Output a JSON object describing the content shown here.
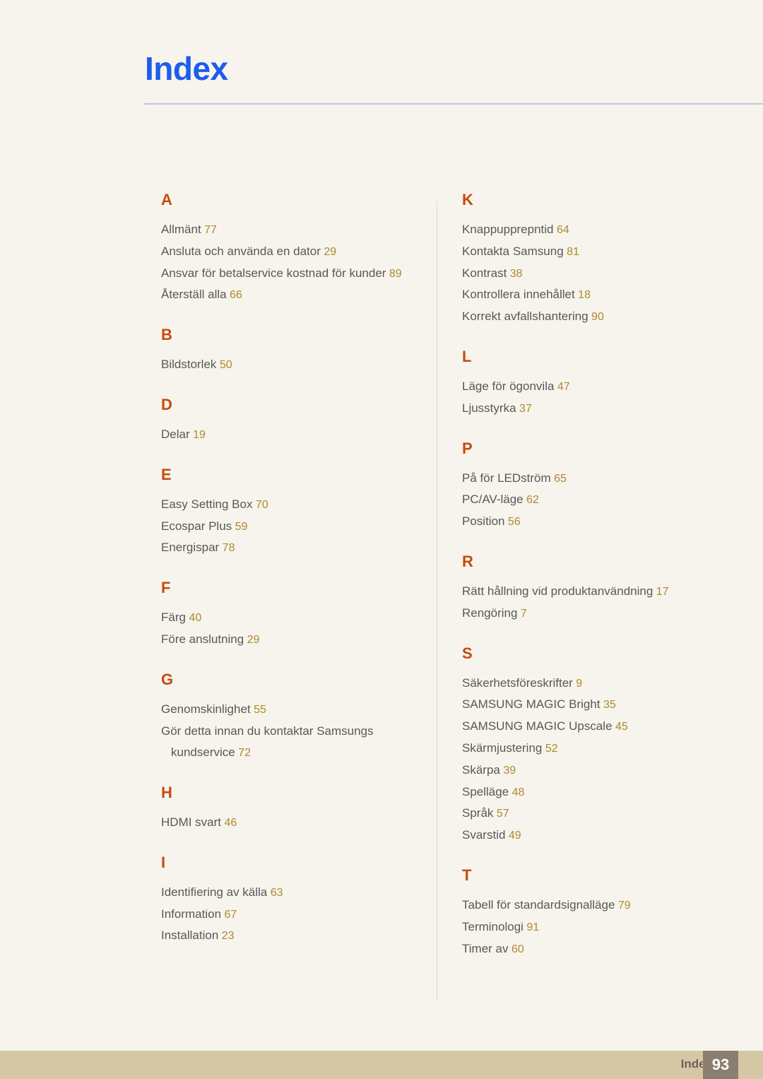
{
  "header": {
    "title": "Index"
  },
  "footer": {
    "label": "Index",
    "page_number": "93"
  },
  "colors": {
    "background": "#f6f4ec",
    "title_blue": "#1d5ced",
    "letter_orange": "#c84a10",
    "entry_gray": "#585858",
    "page_number_gold": "#ae8a2e",
    "rule_lavender": "#c9c2de",
    "divider": "#ded6c4",
    "footer_bar": "#d6c7a4",
    "footer_box": "#8a7f70"
  },
  "columns": {
    "left": [
      {
        "letter": "A",
        "entries": [
          {
            "text": "Allmänt",
            "page": "77"
          },
          {
            "text": "Ansluta och använda en dator",
            "page": "29"
          },
          {
            "text": "Ansvar för betalservice kostnad för kunder",
            "page": "89"
          },
          {
            "text": "Återställ alla",
            "page": "66"
          }
        ]
      },
      {
        "letter": "B",
        "entries": [
          {
            "text": "Bildstorlek",
            "page": "50"
          }
        ]
      },
      {
        "letter": "D",
        "entries": [
          {
            "text": "Delar",
            "page": "19"
          }
        ]
      },
      {
        "letter": "E",
        "entries": [
          {
            "text": "Easy Setting Box",
            "page": "70"
          },
          {
            "text": "Ecospar Plus",
            "page": "59"
          },
          {
            "text": "Energispar",
            "page": "78"
          }
        ]
      },
      {
        "letter": "F",
        "entries": [
          {
            "text": "Färg",
            "page": "40"
          },
          {
            "text": "Före anslutning",
            "page": "29"
          }
        ]
      },
      {
        "letter": "G",
        "entries": [
          {
            "text": "Genomskinlighet",
            "page": "55"
          },
          {
            "text": "Gör detta innan du kontaktar Samsungs",
            "text2": "kundservice",
            "page": "72"
          }
        ]
      },
      {
        "letter": "H",
        "entries": [
          {
            "text": "HDMI svart",
            "page": "46"
          }
        ]
      },
      {
        "letter": "I",
        "entries": [
          {
            "text": "Identifiering av källa",
            "page": "63"
          },
          {
            "text": "Information",
            "page": "67"
          },
          {
            "text": "Installation",
            "page": "23"
          }
        ]
      }
    ],
    "right": [
      {
        "letter": "K",
        "entries": [
          {
            "text": "Knappupprepntid",
            "page": "64"
          },
          {
            "text": "Kontakta Samsung",
            "page": "81"
          },
          {
            "text": "Kontrast",
            "page": "38"
          },
          {
            "text": "Kontrollera innehållet",
            "page": "18"
          },
          {
            "text": "Korrekt avfallshantering",
            "page": "90"
          }
        ]
      },
      {
        "letter": "L",
        "entries": [
          {
            "text": "Läge för ögonvila",
            "page": "47"
          },
          {
            "text": "Ljusstyrka",
            "page": "37"
          }
        ]
      },
      {
        "letter": "P",
        "entries": [
          {
            "text": "På för LEDström",
            "page": "65"
          },
          {
            "text": "PC/AV-läge",
            "page": "62"
          },
          {
            "text": "Position",
            "page": "56"
          }
        ]
      },
      {
        "letter": "R",
        "entries": [
          {
            "text": "Rätt hållning vid produktanvändning",
            "page": "17"
          },
          {
            "text": "Rengöring",
            "page": "7"
          }
        ]
      },
      {
        "letter": "S",
        "entries": [
          {
            "text": "Säkerhetsföreskrifter",
            "page": "9"
          },
          {
            "text": "SAMSUNG MAGIC Bright",
            "page": "35"
          },
          {
            "text": "SAMSUNG MAGIC Upscale",
            "page": "45"
          },
          {
            "text": "Skärmjustering",
            "page": "52"
          },
          {
            "text": "Skärpa",
            "page": "39"
          },
          {
            "text": "Spelläge",
            "page": "48"
          },
          {
            "text": "Språk",
            "page": "57"
          },
          {
            "text": "Svarstid",
            "page": "49"
          }
        ]
      },
      {
        "letter": "T",
        "entries": [
          {
            "text": "Tabell för standardsignalläge",
            "page": "79"
          },
          {
            "text": "Terminologi",
            "page": "91"
          },
          {
            "text": "Timer av",
            "page": "60"
          }
        ]
      }
    ]
  }
}
